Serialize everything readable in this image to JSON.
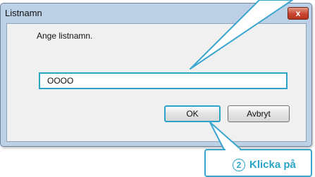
{
  "dialog": {
    "title": "Listnamn",
    "close_glyph": "x",
    "prompt": "Ange listnamn.",
    "input_value": "OOOO",
    "ok_label": "OK",
    "cancel_label": "Avbryt"
  },
  "callout": {
    "step_number": "2",
    "label": "Klicka på"
  },
  "colors": {
    "accent": "#2aa4c9",
    "title_bar": "#bcd0e6",
    "close_button": "#c84630"
  }
}
